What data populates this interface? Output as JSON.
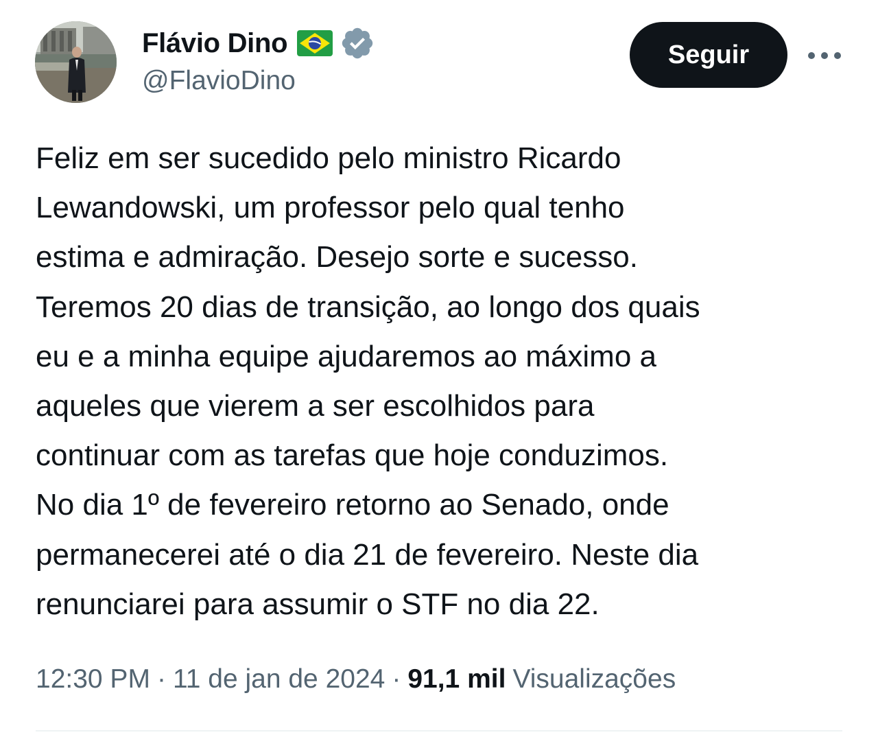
{
  "author": {
    "display_name": "Flávio Dino",
    "handle": "@FlavioDino",
    "flag_icon": "brazil-flag-icon",
    "verified_icon": "verified-badge-icon",
    "verified_color": "#829aab"
  },
  "actions": {
    "follow_label": "Seguir",
    "more_icon": "more-options-icon"
  },
  "tweet": {
    "lines": [
      "Feliz em ser sucedido pelo ministro Ricardo",
      "Lewandowski, um professor pelo qual tenho",
      "estima e admiração. Desejo sorte e sucesso.",
      "Teremos 20 dias de transição, ao longo dos quais",
      "eu e a minha equipe ajudaremos ao máximo a",
      "aqueles que vierem a ser escolhidos para",
      "continuar com as tarefas que hoje conduzimos.",
      "No dia 1º de fevereiro retorno ao Senado, onde",
      "permanecerei até o dia 21 de fevereiro. Neste dia",
      "renunciarei para assumir o STF no dia 22."
    ]
  },
  "meta": {
    "time": "12:30 PM",
    "separator": "·",
    "date": "11 de jan de 2024",
    "views_count": "91,1 mil",
    "views_label": "Visualizações"
  },
  "colors": {
    "text_primary": "#0f1419",
    "text_secondary": "#536471",
    "button_bg": "#0f1419",
    "divider": "#eff3f4"
  }
}
